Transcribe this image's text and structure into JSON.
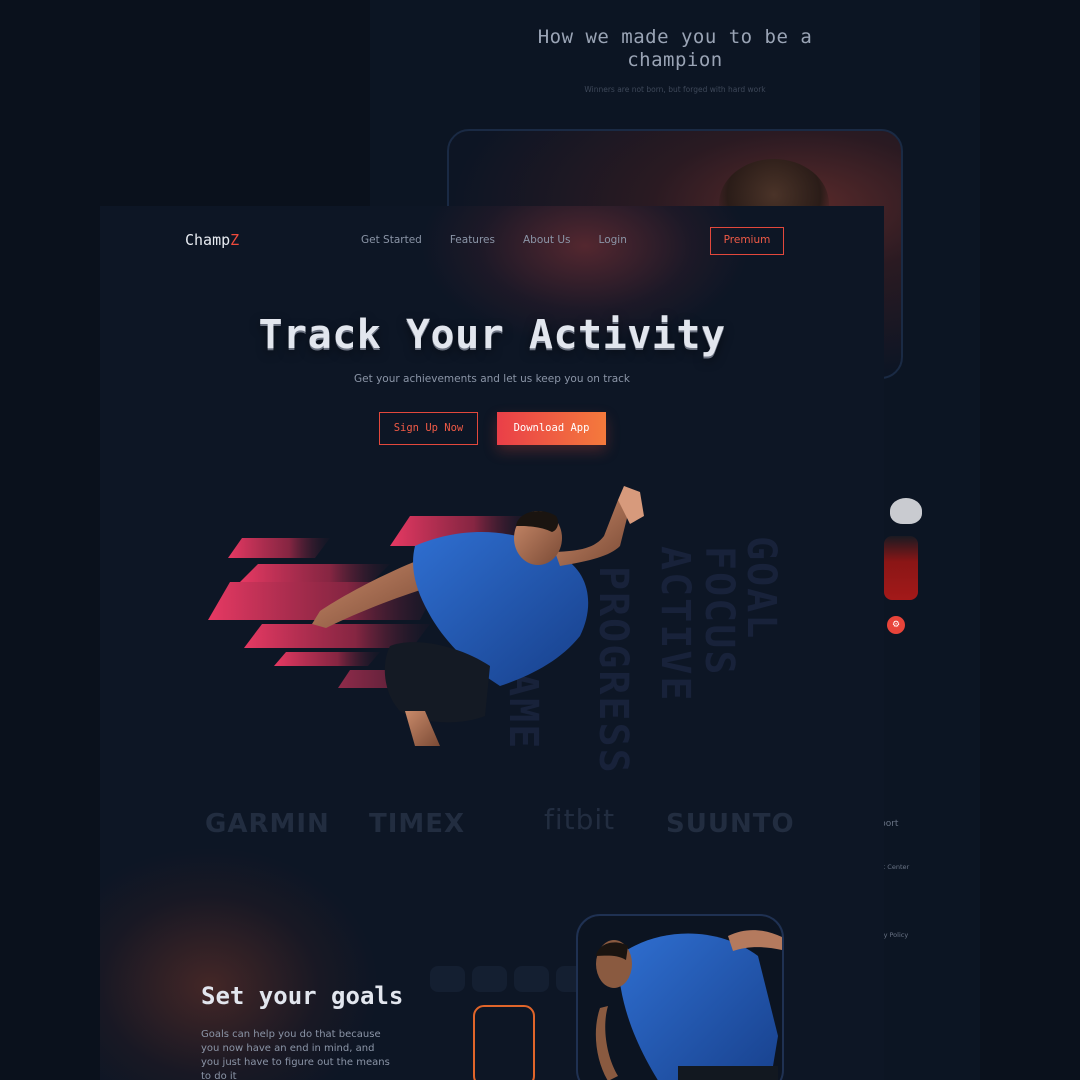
{
  "back_page": {
    "title": "How we made you to be a champion",
    "subtitle": "Winners are not born, but forged with hard work",
    "side_footer": [
      "port",
      "rt Center",
      "cy Policy"
    ]
  },
  "nav": {
    "logo_text": "Champ",
    "logo_accent": "Z",
    "links": [
      "Get Started",
      "Features",
      "About Us",
      "Login"
    ],
    "premium": "Premium"
  },
  "hero": {
    "title": "Track Your Activity",
    "subtitle": "Get your achievements and let us keep you on track",
    "signup": "Sign Up Now",
    "download": "Download App",
    "background_words": [
      "GOAL",
      "FOCUS",
      "ACTIVE",
      "PROGRESS",
      "GAME"
    ]
  },
  "brands": [
    "GARMIN",
    "TIMEX",
    "fitbit",
    "SUUNTO"
  ],
  "goals": {
    "title": "Set your goals",
    "text": "Goals can help you do that because you now have an end in mind, and you just have to figure out the means to do it"
  },
  "colors": {
    "accent": "#ef4a3c",
    "accent_gradient_end": "#f47a3c",
    "background": "#0d1625"
  }
}
